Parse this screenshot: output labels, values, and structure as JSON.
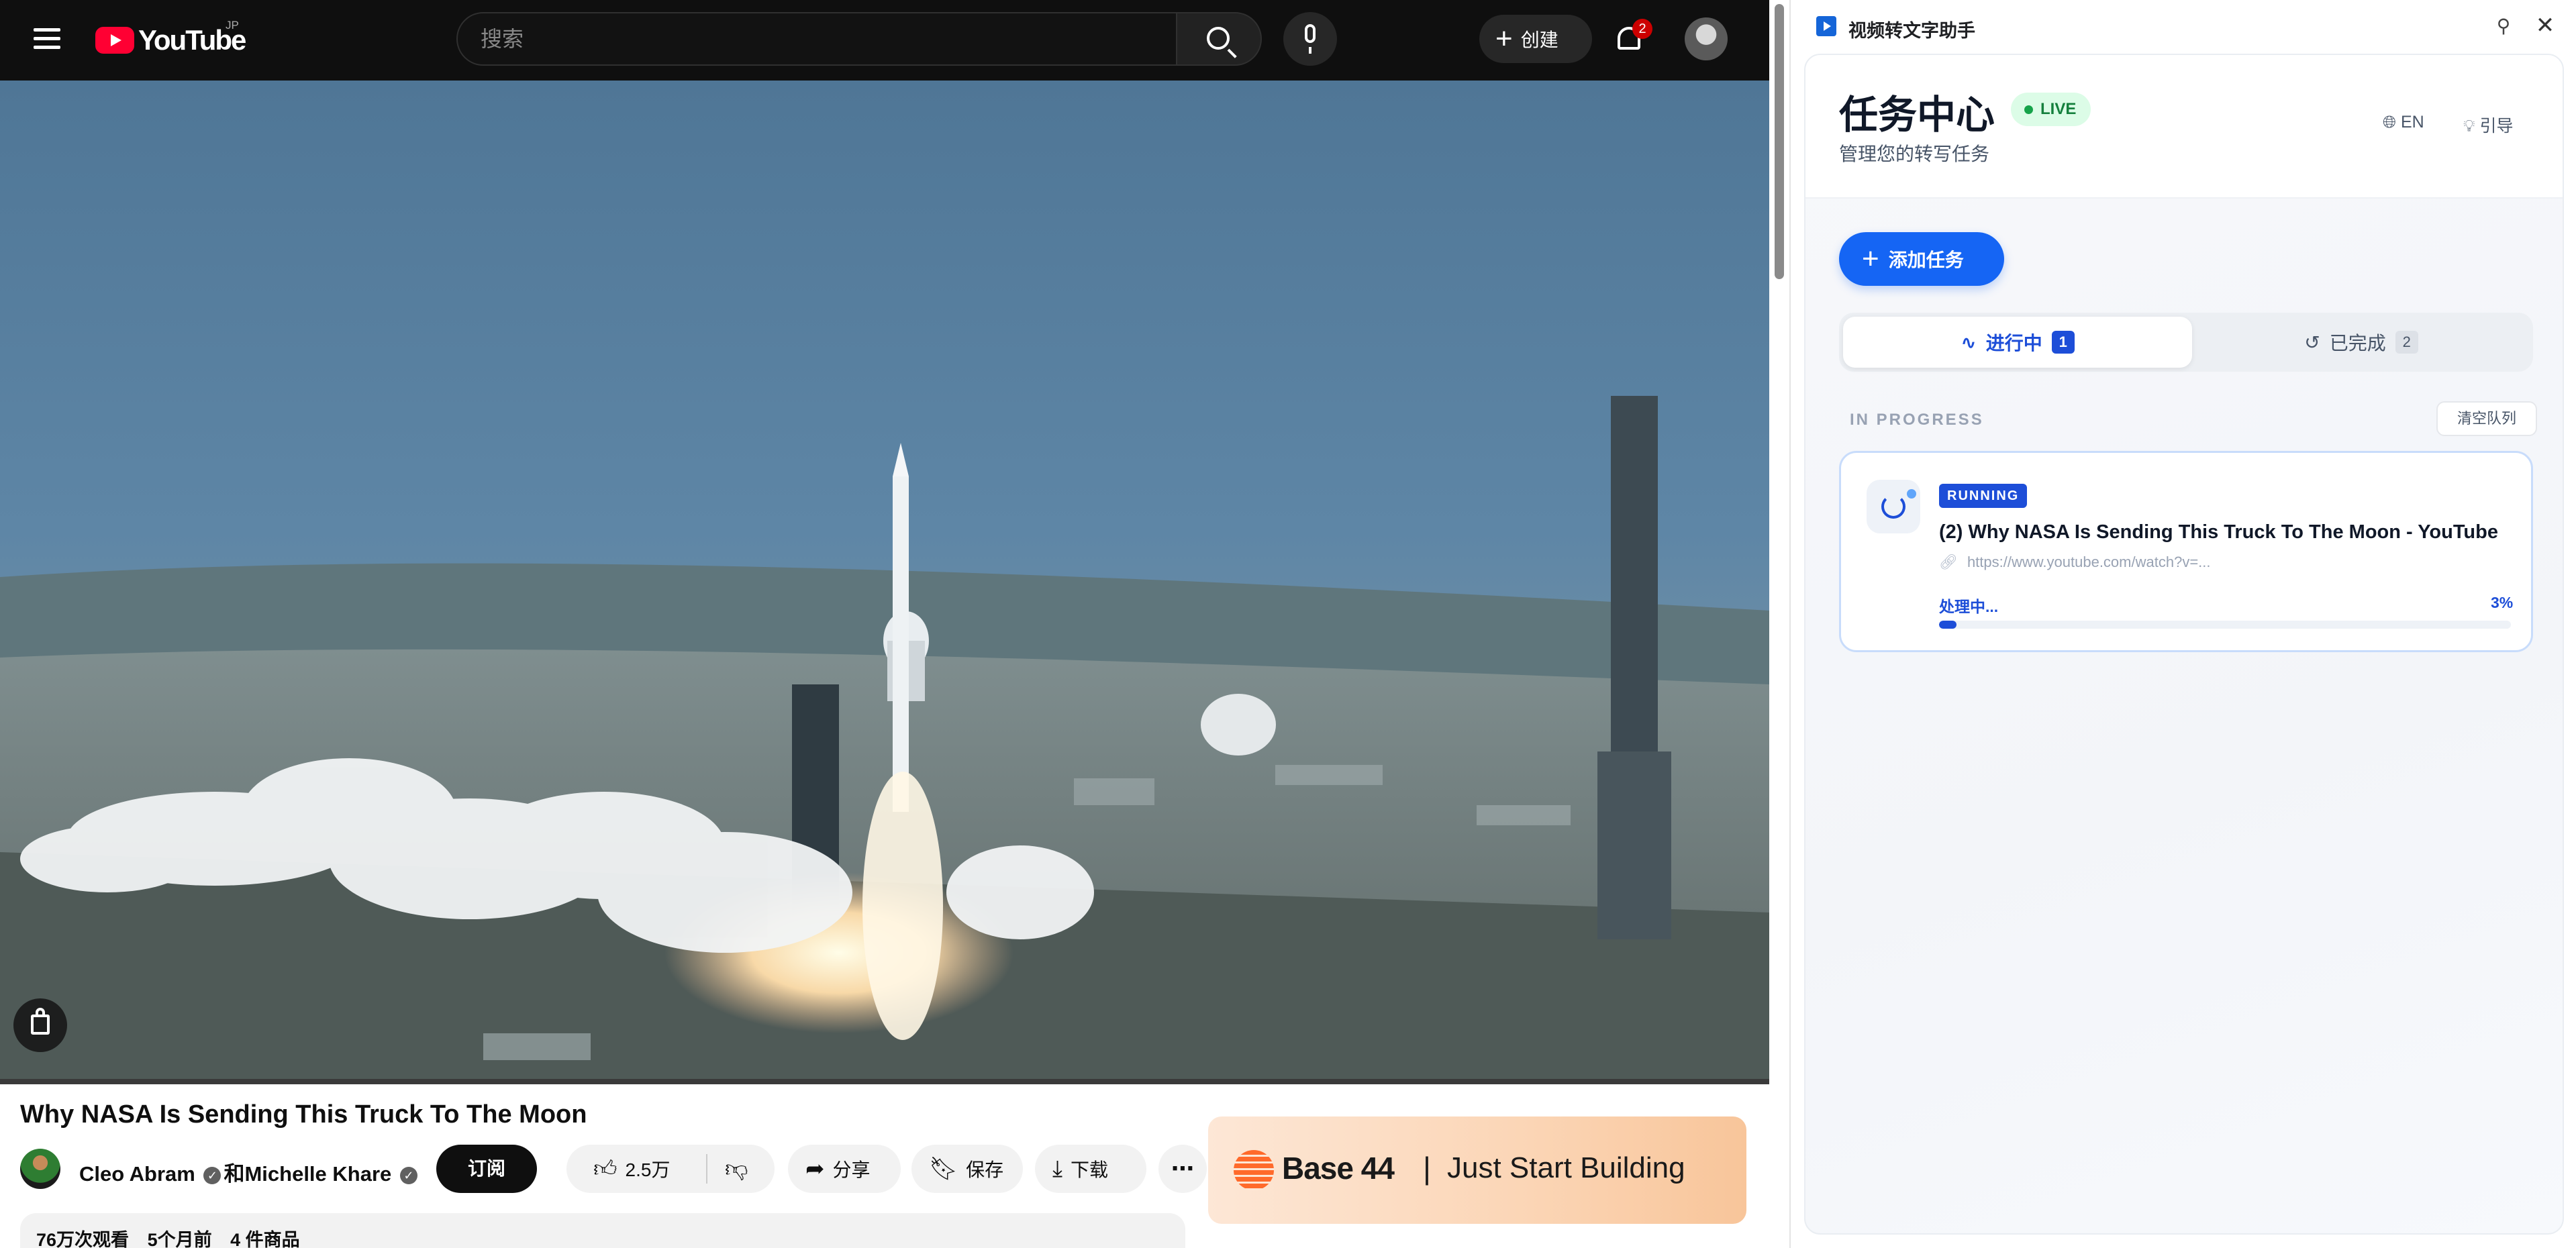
{
  "youtube": {
    "logo_text": "YouTube",
    "region": "JP",
    "search": {
      "placeholder": "搜索"
    },
    "create_label": "创建",
    "notification_count": "2",
    "video": {
      "title": "Why NASA Is Sending This Truck To The Moon",
      "channel_primary": "Cleo Abram",
      "channel_joiner": "和",
      "channel_secondary": "Michelle Khare",
      "subscribe_label": "订阅",
      "likes": "2.5万",
      "share_label": "分享",
      "save_label": "保存",
      "download_label": "下载",
      "views": "76万次观看",
      "age": "5个月前",
      "products": "4 件商品"
    },
    "ad": {
      "brand": "Base 44",
      "separator": "|",
      "tagline": "Just Start Building"
    }
  },
  "extension": {
    "window_title": "视频转文字助手",
    "header": {
      "title": "任务中心",
      "live_badge": "LIVE",
      "subtitle": "管理您的转写任务",
      "lang_label": "EN",
      "guide_label": "引导"
    },
    "add_task_label": "添加任务",
    "tabs": [
      {
        "label": "进行中",
        "count": "1",
        "icon": "activity-icon"
      },
      {
        "label": "已完成",
        "count": "2",
        "icon": "history-icon"
      }
    ],
    "section_label": "IN PROGRESS",
    "clear_queue_label": "清空队列",
    "task": {
      "status_badge": "RUNNING",
      "title": "(2) Why NASA Is Sending This Truck To The Moon - YouTube",
      "url": "https://www.youtube.com/watch?v=...",
      "status_text": "处理中...",
      "progress_label": "3%",
      "progress": 0.03
    }
  },
  "colors": {
    "accent": "#1565f4",
    "live": "#16a34a",
    "youtube_red": "#ff0033"
  }
}
